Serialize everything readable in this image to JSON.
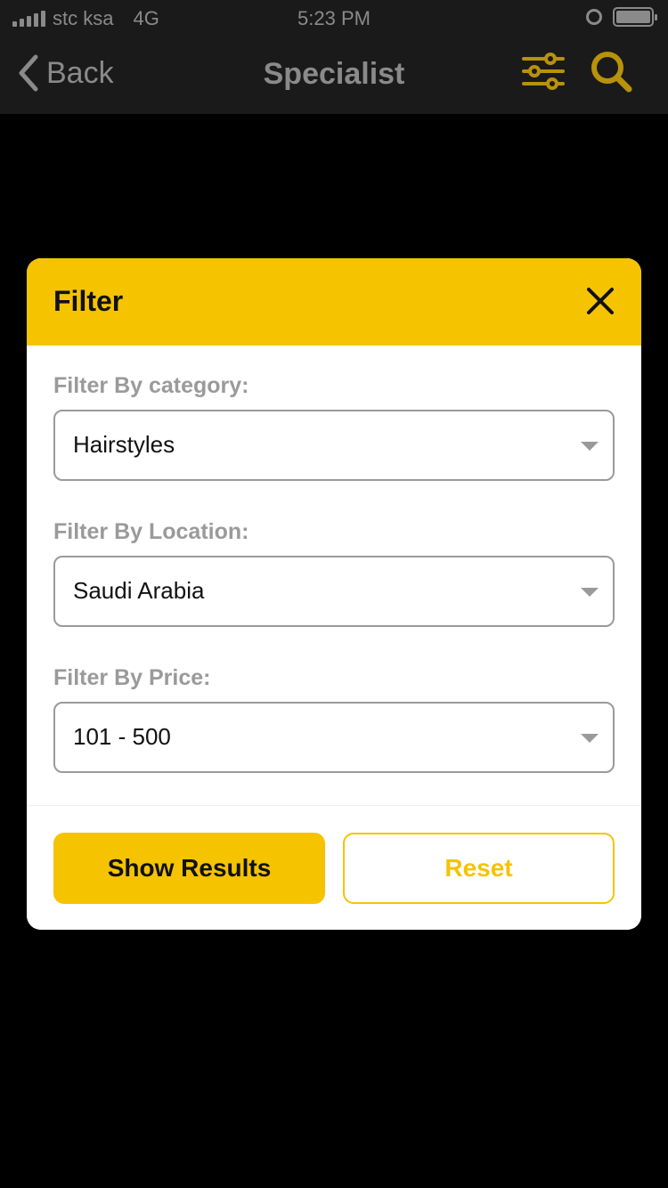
{
  "status_bar": {
    "carrier": "stc ksa",
    "network": "4G",
    "time": "5:23 PM"
  },
  "nav": {
    "back_label": "Back",
    "title": "Specialist",
    "icons": [
      "filter-sliders-icon",
      "search-icon"
    ],
    "accent_color": "#b8920a"
  },
  "modal": {
    "title": "Filter",
    "header_color": "#f5c300",
    "fields": [
      {
        "label": "Filter By category:",
        "value": "Hairstyles"
      },
      {
        "label": "Filter By Location:",
        "value": "Saudi Arabia"
      },
      {
        "label": "Filter By Price:",
        "value": "101 - 500"
      }
    ],
    "show_results_label": "Show Results",
    "reset_label": "Reset"
  }
}
